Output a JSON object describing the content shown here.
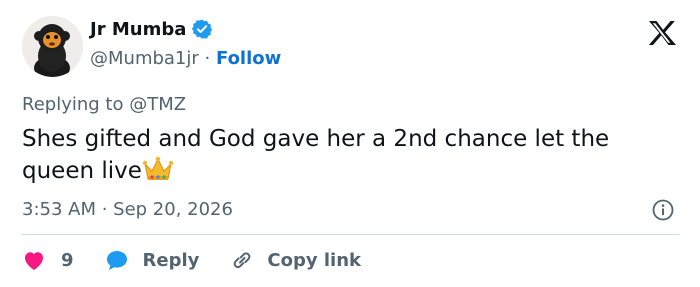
{
  "author": {
    "name": "Jr Mumba",
    "handle": "@Mumba1jr",
    "separator": "·",
    "follow_label": "Follow",
    "verified_color": "#1d9bf0"
  },
  "platform_logo": "x-logo-icon",
  "replying_to": "Replying to @TMZ",
  "tweet_text": "Shes gifted and God gave her a 2nd chance let the queen live",
  "emoji": "crown-emoji",
  "timestamp": "3:53 AM · Sep 20, 2026",
  "actions": {
    "like_count": "9",
    "reply_label": "Reply",
    "copy_link_label": "Copy link"
  },
  "colors": {
    "text": "#0f1419",
    "muted": "#536471",
    "link": "#0f72d2",
    "like": "#f91880",
    "reply": "#1d9bf0",
    "divider": "#cfd9de"
  }
}
